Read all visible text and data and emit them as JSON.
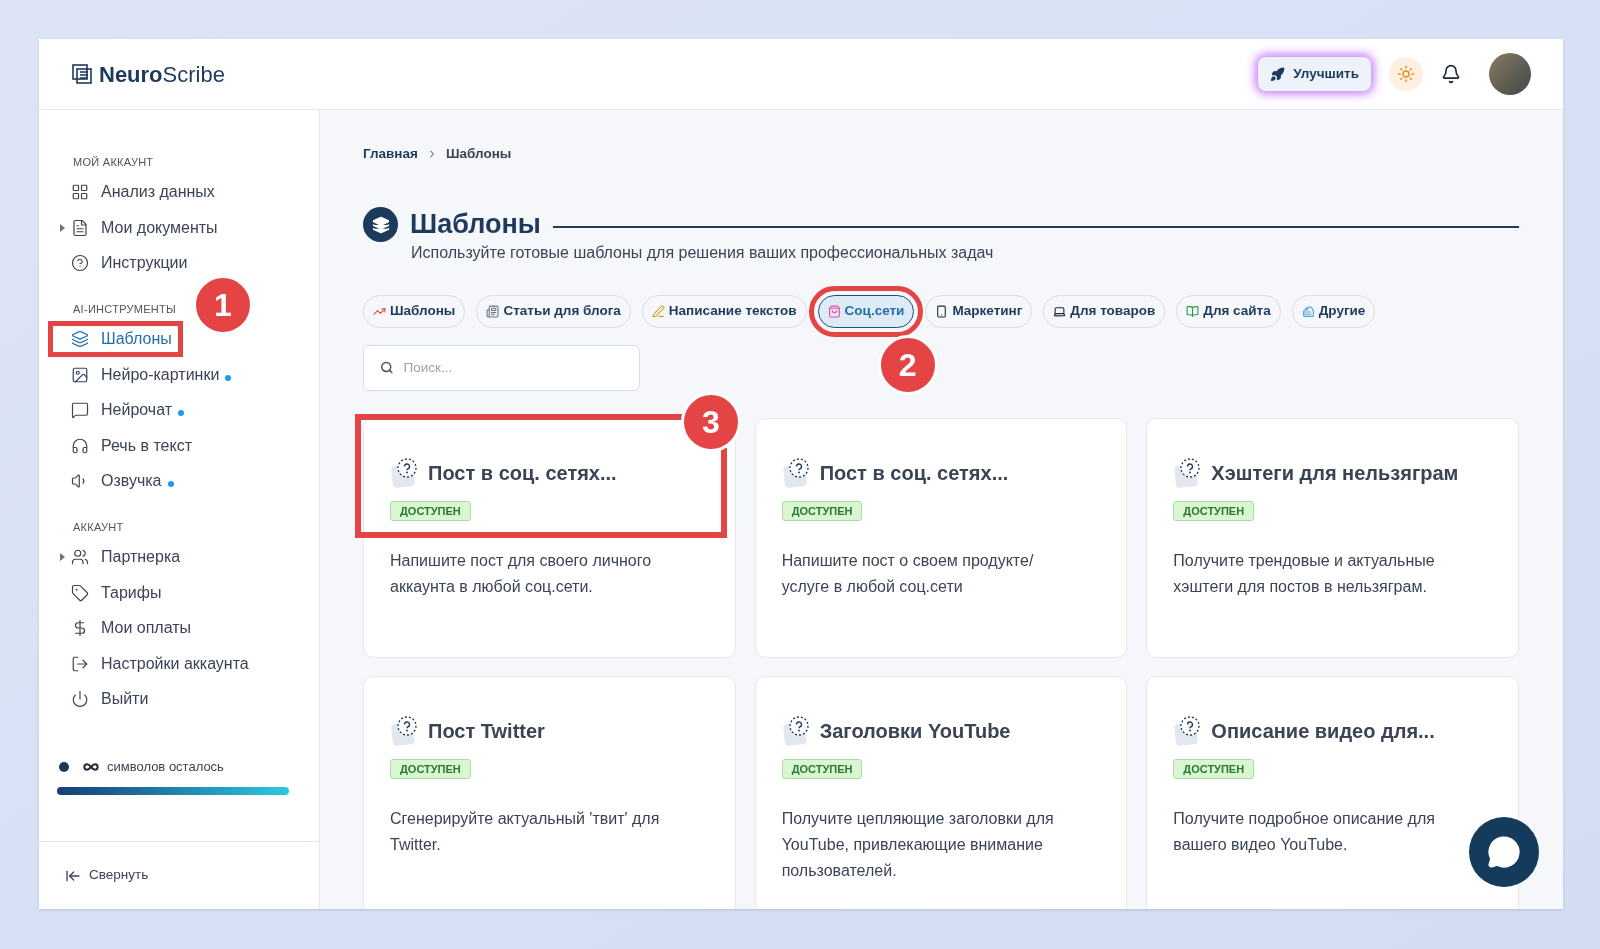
{
  "logo": {
    "bold": "Neuro",
    "light": "Scribe"
  },
  "header": {
    "upgrade_button": "Улучшить"
  },
  "sidebar": {
    "sections": [
      {
        "title": "МОЙ АККАУНТ",
        "items": [
          {
            "label": "Анализ данных",
            "expandable": false,
            "dot": false,
            "selected": false,
            "highlighted": false
          },
          {
            "label": "Мои документы",
            "expandable": true,
            "dot": false,
            "selected": false,
            "highlighted": false
          },
          {
            "label": "Инструкции",
            "expandable": false,
            "dot": false,
            "selected": false,
            "highlighted": false
          }
        ]
      },
      {
        "title": "AI-ИНСТРУМЕНТЫ",
        "items": [
          {
            "label": "Шаблоны",
            "expandable": false,
            "dot": false,
            "selected": true,
            "highlighted": true,
            "callout": "1"
          },
          {
            "label": "Нейро-картинки",
            "expandable": false,
            "dot": true,
            "selected": false,
            "highlighted": false
          },
          {
            "label": "Нейрочат",
            "expandable": false,
            "dot": true,
            "selected": false,
            "highlighted": false
          },
          {
            "label": "Речь в текст",
            "expandable": false,
            "dot": false,
            "selected": false,
            "highlighted": false
          },
          {
            "label": "Озвучка",
            "expandable": false,
            "dot": true,
            "selected": false,
            "highlighted": false
          }
        ]
      },
      {
        "title": "АККАУНТ",
        "items": [
          {
            "label": "Партнерка",
            "expandable": true,
            "dot": false,
            "selected": false,
            "highlighted": false
          },
          {
            "label": "Тарифы",
            "expandable": false,
            "dot": false,
            "selected": false,
            "highlighted": false
          },
          {
            "label": "Мои оплаты",
            "expandable": false,
            "dot": false,
            "selected": false,
            "highlighted": false
          },
          {
            "label": "Настройки аккаунта",
            "expandable": false,
            "dot": false,
            "selected": false,
            "highlighted": false
          },
          {
            "label": "Выйти",
            "expandable": false,
            "dot": false,
            "selected": false,
            "highlighted": false
          }
        ]
      }
    ],
    "quota": {
      "label": "символов осталось"
    },
    "collapse": "Свернуть"
  },
  "breadcrumb": [
    "Главная",
    "Шаблоны"
  ],
  "page": {
    "title": "Шаблоны",
    "subtitle": "Используйте готовые шаблоны для решения ваших профессиональных задач"
  },
  "tabs": [
    {
      "label": "Шаблоны",
      "selected": false,
      "highlighted": false
    },
    {
      "label": "Статьи для блога",
      "selected": false,
      "highlighted": false
    },
    {
      "label": "Написание текстов",
      "selected": false,
      "highlighted": false
    },
    {
      "label": "Соц.сети",
      "selected": true,
      "highlighted": true,
      "callout": "2"
    },
    {
      "label": "Маркетинг",
      "selected": false,
      "highlighted": false
    },
    {
      "label": "Для товаров",
      "selected": false,
      "highlighted": false
    },
    {
      "label": "Для сайта",
      "selected": false,
      "highlighted": false
    },
    {
      "label": "Другие",
      "selected": false,
      "highlighted": false
    }
  ],
  "search": {
    "placeholder": "Поиск..."
  },
  "cards": [
    {
      "title": "Пост в соц. сетях...",
      "status": "ДОСТУПЕН",
      "description": "Напишите пост для своего личного аккаунта в любой соц.сети.",
      "highlighted": true,
      "callout": "3"
    },
    {
      "title": "Пост в соц. сетях...",
      "status": "ДОСТУПЕН",
      "description": "Напишите пост о своем продукте/ услуге в любой соц.сети",
      "highlighted": false
    },
    {
      "title": "Хэштеги для нельзяграм",
      "status": "ДОСТУПЕН",
      "description": "Получите трендовые и актуальные хэштеги для постов в нельзяграм.",
      "highlighted": false
    },
    {
      "title": "Пост Twitter",
      "status": "ДОСТУПЕН",
      "description": "Сгенерируйте актуальный 'твит' для Twitter.",
      "highlighted": false
    },
    {
      "title": "Заголовки YouTube",
      "status": "ДОСТУПЕН",
      "description": "Получите цепляющие заголовки для YouTube, привлекающие внимание пользователей.",
      "highlighted": false
    },
    {
      "title": "Описание видео для...",
      "status": "ДОСТУПЕН",
      "description": "Получите подробное описание для вашего видео YouTube.",
      "highlighted": false
    }
  ]
}
